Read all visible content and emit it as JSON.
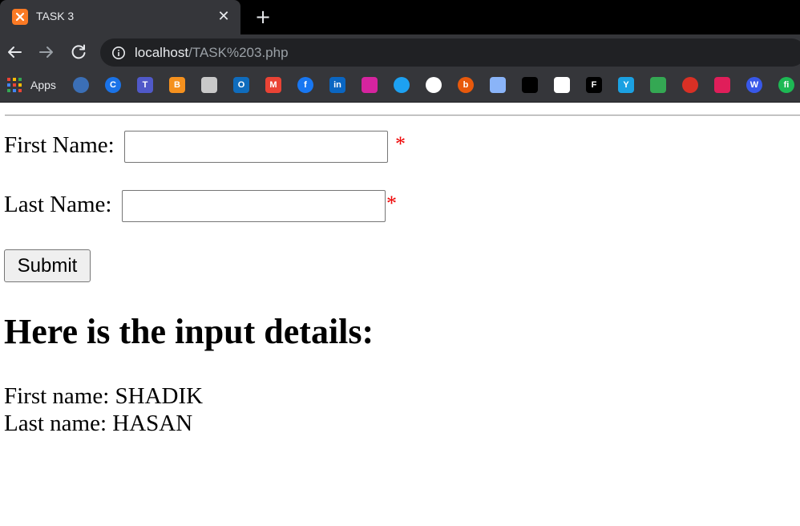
{
  "browser": {
    "tab_title": "TASK 3",
    "url_host": "localhost",
    "url_path": "/TASK%203.php",
    "apps_label": "Apps",
    "bookmarks": [
      {
        "name": "bookmark-shield-icon",
        "glyph": "",
        "color": "#3b6fb6",
        "round": true
      },
      {
        "name": "bookmark-c-icon",
        "glyph": "C",
        "color": "#1a73e8",
        "round": true
      },
      {
        "name": "bookmark-teams-icon",
        "glyph": "T",
        "color": "#5059c9",
        "round": false
      },
      {
        "name": "bookmark-blogger-icon",
        "glyph": "B",
        "color": "#f5911e",
        "round": false
      },
      {
        "name": "bookmark-image-icon",
        "glyph": "",
        "color": "#c9c9c9",
        "round": false
      },
      {
        "name": "bookmark-outlook-icon",
        "glyph": "O",
        "color": "#0f6cbd",
        "round": false
      },
      {
        "name": "bookmark-gmail-icon",
        "glyph": "M",
        "color": "#ea4335",
        "round": false
      },
      {
        "name": "bookmark-facebook-icon",
        "glyph": "f",
        "color": "#1877f2",
        "round": true
      },
      {
        "name": "bookmark-linkedin-icon",
        "glyph": "in",
        "color": "#0a66c2",
        "round": false
      },
      {
        "name": "bookmark-instagram-icon",
        "glyph": "",
        "color": "#d6249f",
        "round": false
      },
      {
        "name": "bookmark-twitter-icon",
        "glyph": "",
        "color": "#1da1f2",
        "round": true
      },
      {
        "name": "bookmark-github-icon",
        "glyph": "",
        "color": "#ffffff",
        "round": true
      },
      {
        "name": "bookmark-b-icon",
        "glyph": "b",
        "color": "#e8590c",
        "round": true
      },
      {
        "name": "bookmark-shapes-icon",
        "glyph": "",
        "color": "#8ab4f8",
        "round": false
      },
      {
        "name": "bookmark-menu-icon",
        "glyph": "",
        "color": "#000000",
        "round": false
      },
      {
        "name": "bookmark-green-circle-icon",
        "glyph": "",
        "color": "#ffffff",
        "round": false
      },
      {
        "name": "bookmark-f-icon",
        "glyph": "F",
        "color": "#000000",
        "round": false
      },
      {
        "name": "bookmark-y-icon",
        "glyph": "Y",
        "color": "#1ba1e2",
        "round": false
      },
      {
        "name": "bookmark-drive-icon",
        "glyph": "",
        "color": "#34a853",
        "round": false
      },
      {
        "name": "bookmark-ring-icon",
        "glyph": "",
        "color": "#d93025",
        "round": true
      },
      {
        "name": "bookmark-dots-icon",
        "glyph": "",
        "color": "#e01e5a",
        "round": false
      },
      {
        "name": "bookmark-wordpress-icon",
        "glyph": "W",
        "color": "#3858e9",
        "round": true
      },
      {
        "name": "bookmark-fi-icon",
        "glyph": "fi",
        "color": "#1db954",
        "round": true
      }
    ]
  },
  "form": {
    "first_name_label": "First Name:",
    "first_name_value": "",
    "last_name_label": "Last Name:",
    "last_name_value": "",
    "required_marker": "*",
    "submit_label": "Submit"
  },
  "results": {
    "heading": "Here is the input details:",
    "first_name_line": "First name: SHADIK",
    "last_name_line": "Last name: HASAN"
  }
}
